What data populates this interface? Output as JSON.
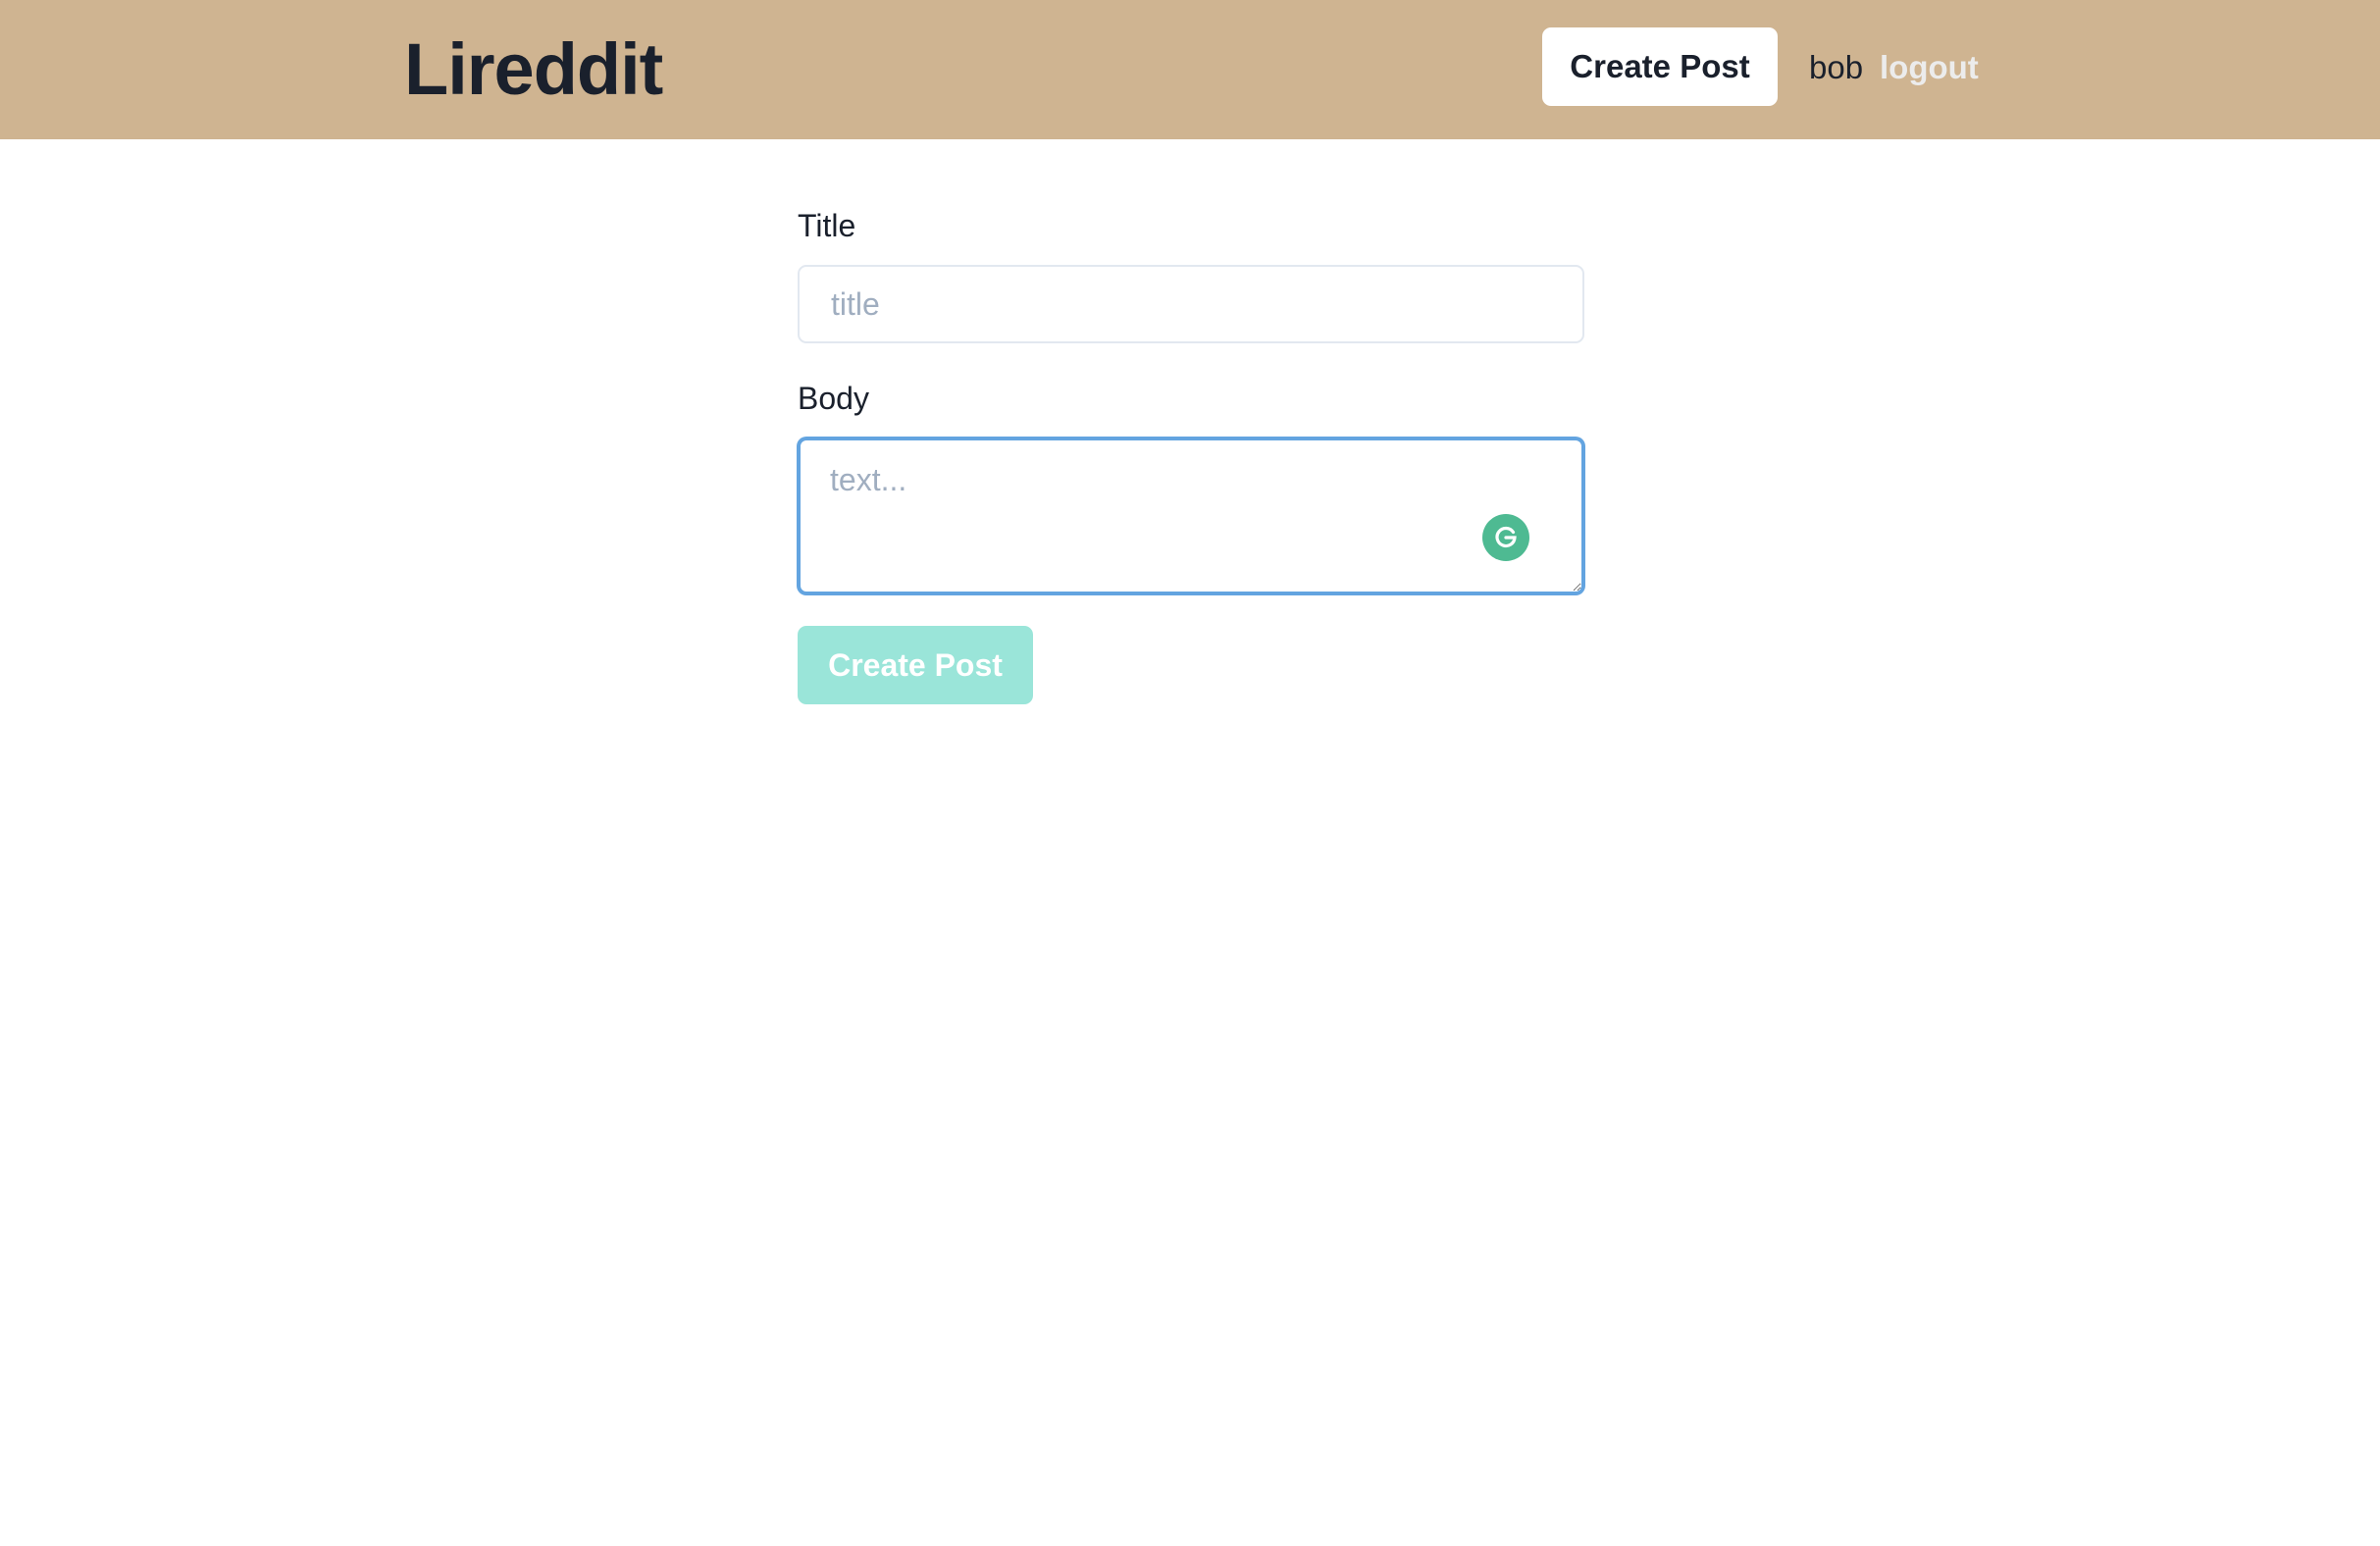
{
  "navbar": {
    "logo": "Lireddit",
    "create_post_label": "Create Post",
    "username": "bob",
    "logout_label": "logout"
  },
  "form": {
    "title_label": "Title",
    "title_placeholder": "title",
    "title_value": "",
    "body_label": "Body",
    "body_placeholder": "text...",
    "body_value": "",
    "submit_label": "Create Post",
    "grammarly_icon": "grammarly-icon"
  },
  "colors": {
    "navbar_bg": "#cfb491",
    "submit_bg": "#9ae5d9",
    "focus_border": "#63a4e0",
    "grammarly": "#4eba92"
  }
}
